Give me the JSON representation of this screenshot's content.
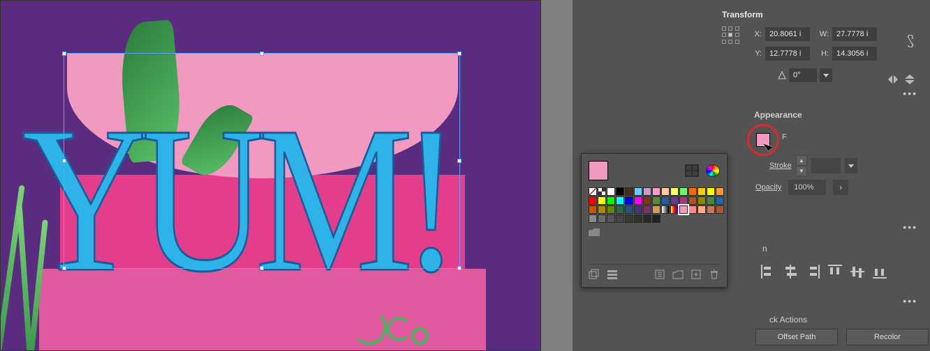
{
  "canvas": {
    "text": "YUM!"
  },
  "transform": {
    "title": "Transform",
    "x_label": "X:",
    "x_value": "20.8061 i",
    "y_label": "Y:",
    "y_value": "12.7778 i",
    "w_label": "W:",
    "w_value": "27.7778 i",
    "h_label": "H:",
    "h_value": "14.3056 i",
    "rotate_value": "0°"
  },
  "appearance": {
    "title": "Appearance",
    "fill_letter": "F",
    "stroke_label": "Stroke",
    "stroke_value": "",
    "opacity_label": "Opacity",
    "opacity_value": "100%"
  },
  "align": {
    "partial_label": "n"
  },
  "quick_actions": {
    "title_partial": "ck Actions",
    "offset_path": "Offset Path",
    "recolor": "Recolor"
  },
  "swatch_popup": {
    "current_color": "#f299c1",
    "rows": [
      [
        "none",
        "reg",
        "#ffffff",
        "#000000",
        "#4a2c17",
        "#66ccff",
        "#cc99cc",
        "#ff99cc",
        "#ffcc99",
        "#ffff66",
        "#66ff66",
        "#ff6600",
        "#ffcc00",
        "#ffff00",
        "#ff9933"
      ],
      [
        "#ff0000",
        "#ffff00",
        "#00ff00",
        "#00ffff",
        "#0000ff",
        "#ff00ff",
        "#803515",
        "#5a8a3a",
        "#2c5aa0",
        "#6a3a8a",
        "#a03a7a",
        "#aa5522",
        "#888800",
        "#448844",
        "#2266aa"
      ],
      [
        "#cc5500",
        "#aa8800",
        "#668800",
        "#336644",
        "#225577",
        "#443377",
        "#773366",
        "#d69955",
        "linear1",
        "linear2",
        "#f299c1",
        "#ff8888",
        "#ffaa88",
        "#cc7755",
        "#aa5533"
      ],
      [
        "#8a8a8a",
        "#6a6a6a",
        "#555555",
        "#444444",
        "#383838",
        "#303030",
        "#282828",
        "#202020"
      ]
    ]
  }
}
